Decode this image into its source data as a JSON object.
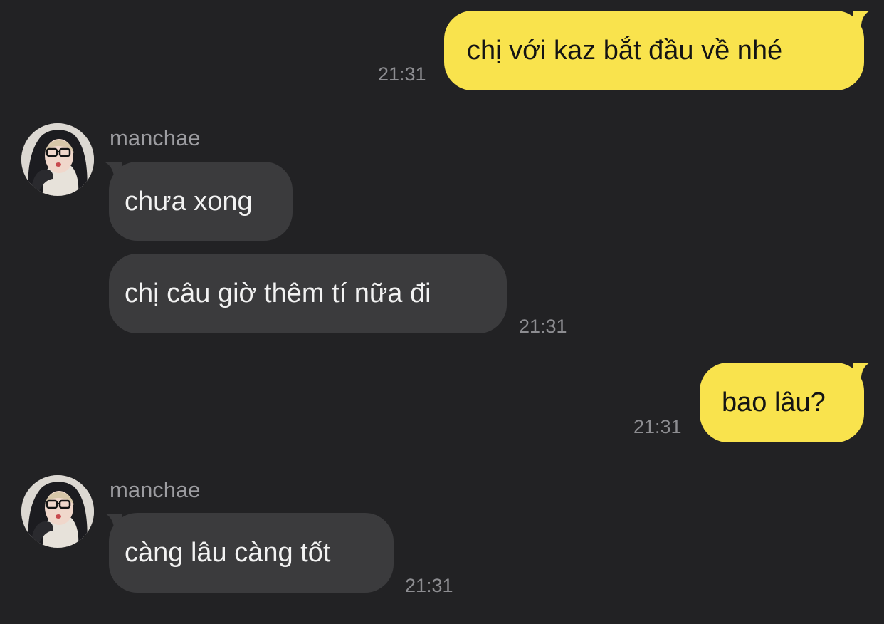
{
  "contact": {
    "name": "manchae",
    "avatar_icon": "profile-photo"
  },
  "colors": {
    "background": "#222224",
    "outgoing_bubble": "#f9e34d",
    "incoming_bubble": "#3b3b3d",
    "timestamp": "#8d8d91"
  },
  "messages": [
    {
      "direction": "outgoing",
      "text": "chị với kaz bắt đầu về nhé",
      "time": "21:31"
    },
    {
      "direction": "incoming",
      "sender": "manchae",
      "text": "chưa xong"
    },
    {
      "direction": "incoming",
      "text": "chị câu giờ thêm tí nữa đi",
      "time": "21:31"
    },
    {
      "direction": "outgoing",
      "text": "bao lâu?",
      "time": "21:31"
    },
    {
      "direction": "incoming",
      "sender": "manchae",
      "text": "càng lâu càng tốt",
      "time": "21:31"
    }
  ]
}
